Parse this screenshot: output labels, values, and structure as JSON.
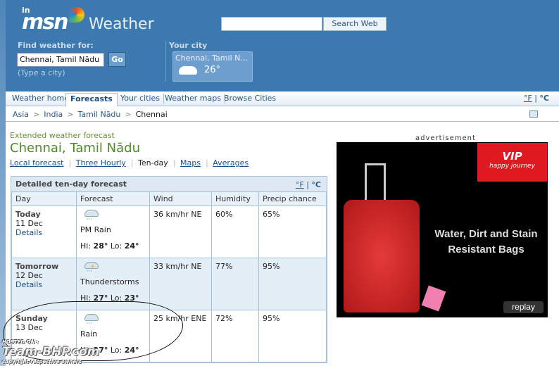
{
  "header": {
    "brand_in": "in",
    "brand": "msn",
    "title": "Weather",
    "search_button": "Search Web",
    "search_value": "",
    "find_label": "Find weather for:",
    "city_value": "Chennai, Tamil Nādu",
    "go_label": "Go",
    "hint": "(Type a city)",
    "your_city_label": "Your city",
    "your_city_name": "Chennai, Tamil N...",
    "your_city_temp": "26°"
  },
  "nav": {
    "tabs": [
      "Weather home",
      "Forecasts",
      "Your cities",
      "Weather maps",
      "Browse Cities"
    ],
    "active": "Forecasts",
    "unit_f": "°F",
    "unit_sep": "|",
    "unit_c": "°C"
  },
  "breadcrumb": [
    "Asia",
    "India",
    "Tamil Nādu",
    "Chennai"
  ],
  "breadcrumb_sep": ">",
  "page": {
    "subtitle": "Extended weather forecast",
    "title": "Chennai, Tamil Nādu",
    "links": [
      "Local forecast",
      "Three Hourly",
      "Ten-day",
      "Maps",
      "Averages"
    ],
    "sep": "|"
  },
  "forecast": {
    "title": "Detailed ten-day forecast",
    "unit_f": "°F",
    "unit_sep": "|",
    "unit_c": "°C",
    "columns": [
      "Day",
      "Forecast",
      "Wind",
      "Humidity",
      "Precip chance"
    ],
    "rows": [
      {
        "day": "Today",
        "date": "11 Dec",
        "details": "Details",
        "icon": "rain-cloud-icon",
        "condition": "PM Rain",
        "hi_label": "Hi:",
        "hi": "28°",
        "lo_label": "Lo:",
        "lo": "24°",
        "wind": "36 km/hr NE",
        "humidity": "60%",
        "precip": "65%"
      },
      {
        "day": "Tomorrow",
        "date": "12 Dec",
        "details": "Details",
        "icon": "thunderstorm-icon",
        "condition": "Thunderstorms",
        "hi_label": "Hi:",
        "hi": "27°",
        "lo_label": "Lo:",
        "lo": "23°",
        "wind": "33 km/hr NE",
        "humidity": "77%",
        "precip": "95%"
      },
      {
        "day": "Sunday",
        "date": "13 Dec",
        "icon": "rain-cloud-icon",
        "condition": "Rain",
        "hi_label": "Hi:",
        "hi": "27°",
        "lo_label": "Lo:",
        "lo": "24°",
        "wind": "25 km/hr ENE",
        "humidity": "72%",
        "precip": "95%"
      }
    ]
  },
  "ad": {
    "label": "advertisement",
    "brand": "VIP",
    "tagline": "happy journey",
    "headline": "Water, Dirt and Stain Resistant Bags",
    "replay": "replay"
  },
  "watermark": {
    "top": "HOSTED ON :",
    "site": "Team-BHP.com",
    "bottom": "copyright respective owners"
  },
  "colors": {
    "header": "#3c79ae",
    "title_green": "#4e8a2a",
    "link": "#1d4f8a"
  }
}
